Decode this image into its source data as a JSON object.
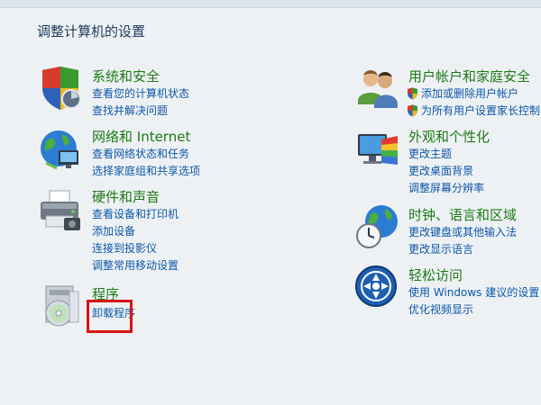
{
  "page_title": "调整计算机的设置",
  "left": [
    {
      "icon": "security-shield-icon",
      "title": "系统和安全",
      "links": [
        "查看您的计算机状态",
        "查找并解决问题"
      ]
    },
    {
      "icon": "network-globe-icon",
      "title": "网络和 Internet",
      "links": [
        "查看网络状态和任务",
        "选择家庭组和共享选项"
      ]
    },
    {
      "icon": "printer-icon",
      "title": "硬件和声音",
      "links": [
        "查看设备和打印机",
        "添加设备",
        "连接到投影仪",
        "调整常用移动设置"
      ]
    },
    {
      "icon": "programs-disc-icon",
      "title": "程序",
      "links": [
        "卸载程序"
      ]
    }
  ],
  "right": [
    {
      "icon": "users-icon",
      "title": "用户帐户和家庭安全",
      "links": [
        "添加或删除用户帐户",
        "为所有用户设置家长控制"
      ],
      "shielded": [
        true,
        true
      ]
    },
    {
      "icon": "appearance-monitor-icon",
      "title": "外观和个性化",
      "links": [
        "更改主题",
        "更改桌面背景",
        "调整屏幕分辨率"
      ]
    },
    {
      "icon": "clock-globe-icon",
      "title": "时钟、语言和区域",
      "links": [
        "更改键盘或其他输入法",
        "更改显示语言"
      ]
    },
    {
      "icon": "ease-of-access-icon",
      "title": "轻松访问",
      "links": [
        "使用 Windows 建议的设置",
        "优化视频显示"
      ]
    }
  ],
  "highlight_color": "#d81414"
}
